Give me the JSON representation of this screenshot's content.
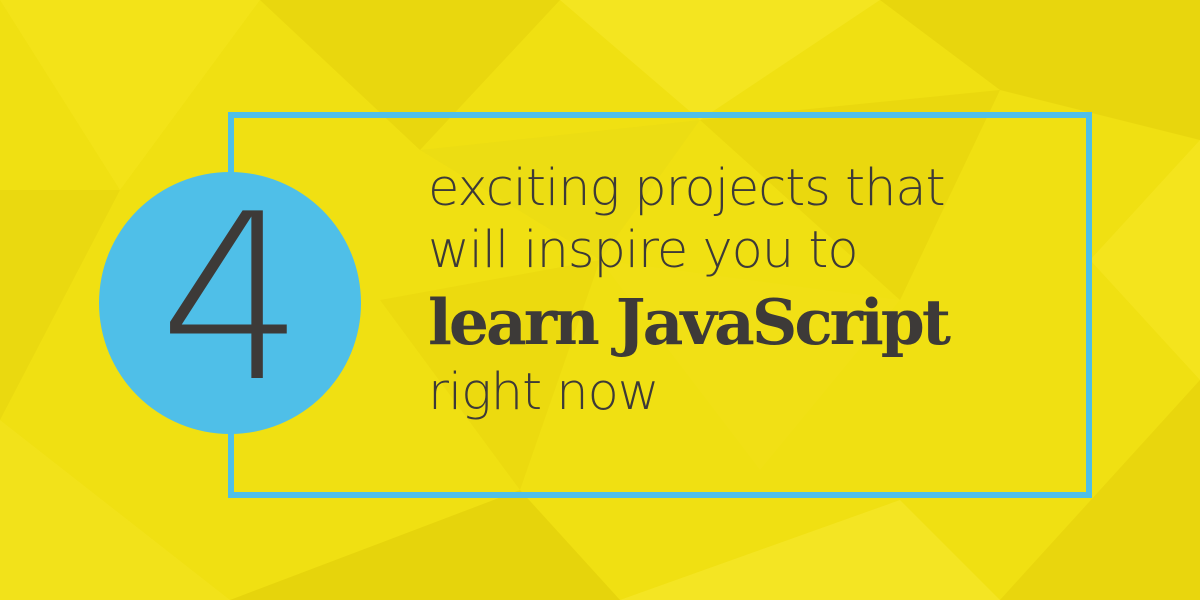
{
  "badge": {
    "number": "4"
  },
  "headline": {
    "line1": "exciting projects that",
    "line2": "will inspire you to",
    "emphasis": "learn JavaScript",
    "line4": "right now"
  },
  "colors": {
    "background": "#f0e012",
    "accent": "#4fbfe8",
    "text": "#3d3a38"
  }
}
